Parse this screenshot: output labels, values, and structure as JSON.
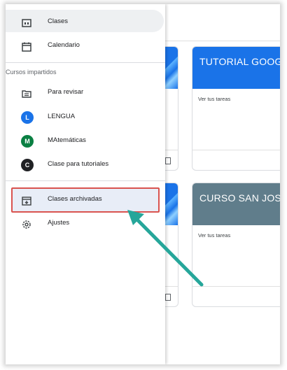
{
  "drawer": {
    "items_top": [
      {
        "label": "Clases",
        "icon": "classes-icon"
      },
      {
        "label": "Calendario",
        "icon": "calendar-icon"
      }
    ],
    "section_title": "Cursos impartidos",
    "courses": [
      {
        "label": "Para revisar",
        "icon": "review-icon"
      },
      {
        "label": "LENGUA",
        "avatar": "L",
        "color": "#1a73e8"
      },
      {
        "label": "MAtemáticas",
        "avatar": "M",
        "color": "#0b8043"
      },
      {
        "label": "Clase para tutoriales",
        "avatar": "C",
        "color": "#202124"
      }
    ],
    "archived": {
      "label": "Clases archivadas",
      "icon": "archive-icon"
    },
    "settings": {
      "label": "Ajustes",
      "icon": "gear-icon"
    }
  },
  "cards": [
    {
      "title": "TUTORIAL GOOGLE",
      "tasks": "Ver tus tareas",
      "color": "#1a73e8"
    },
    {
      "title": "CURSO SAN JOSÉ",
      "tasks": "Ver tus tareas",
      "color": "#607d8b"
    }
  ],
  "colors": {
    "highlight_border": "#d9534f",
    "arrow": "#26a69a"
  }
}
